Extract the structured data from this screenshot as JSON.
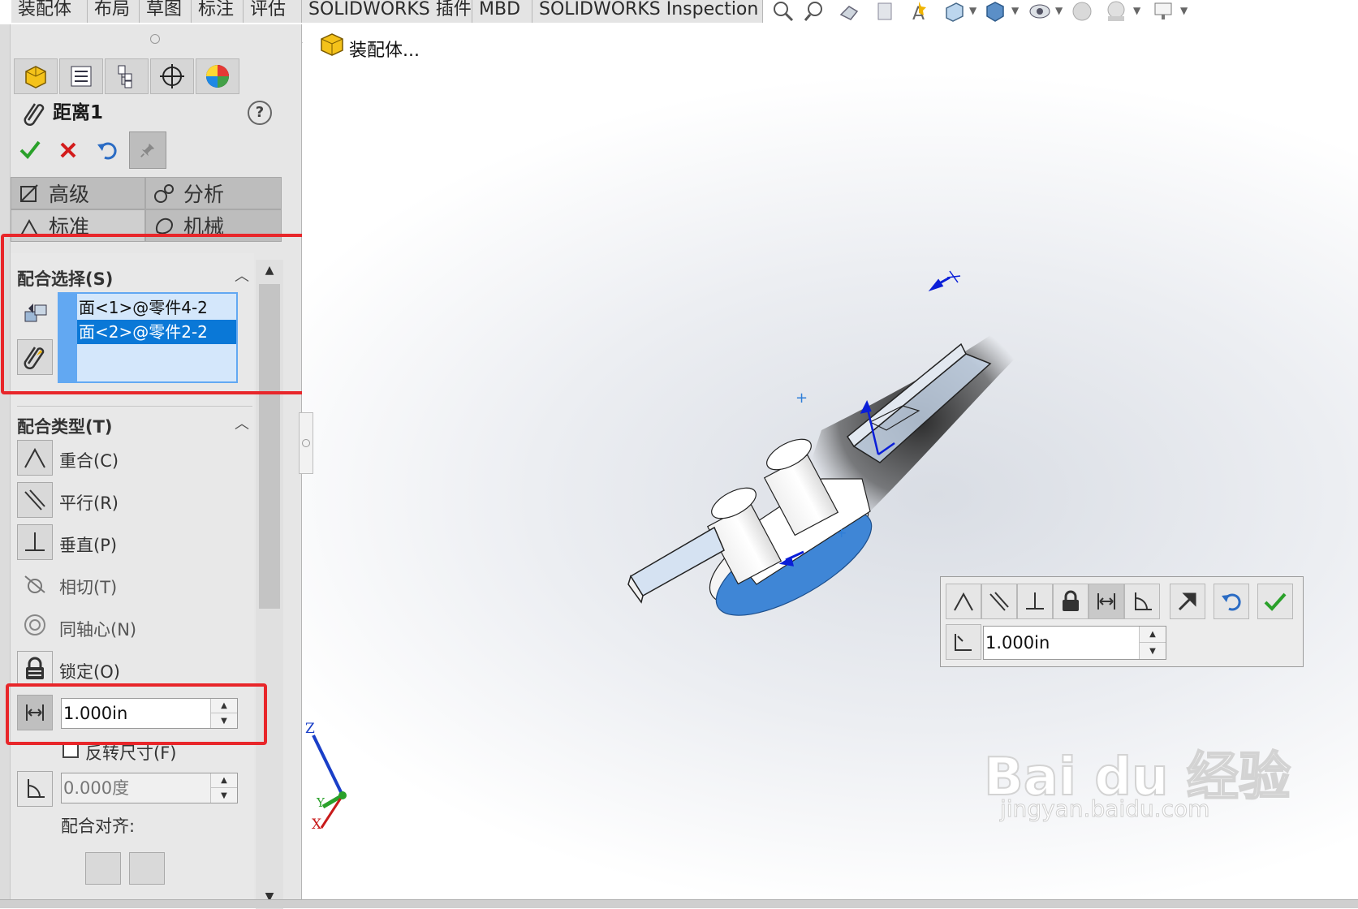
{
  "ribbon": {
    "tabs": [
      "装配体",
      "布局",
      "草图",
      "标注",
      "评估",
      "SOLIDWORKS 插件",
      "MBD",
      "SOLIDWORKS Inspection"
    ],
    "view_icons": [
      "zoom-to-fit-icon",
      "zoom-to-area-icon",
      "previous-view-icon",
      "section-view-icon",
      "dynamic-annotation-icon",
      "view-orientation-icon",
      "display-style-icon",
      "hide-show-icon",
      "edit-appearance-icon",
      "apply-scene-icon",
      "view-settings-icon"
    ]
  },
  "property_manager": {
    "tabs": [
      "feature-manager-icon",
      "property-manager-icon",
      "configuration-manager-icon",
      "dimxpert-icon",
      "display-manager-icon"
    ],
    "title": "距离1",
    "help_icon": "?",
    "pm_tabs": {
      "advanced": "高级",
      "analysis": "分析",
      "standard": "标准",
      "mechanical": "机械"
    },
    "mate_selection": {
      "title": "配合选择(S)",
      "items": [
        "面<1>@零件4-2",
        "面<2>@零件2-2"
      ]
    },
    "mate_types": {
      "title": "配合类型(T)",
      "items": [
        "重合(C)",
        "平行(R)",
        "垂直(P)",
        "相切(T)",
        "同轴心(N)",
        "锁定(O)"
      ]
    },
    "distance_value": "1.000in",
    "flip_dimension": "反转尺寸(F)",
    "angle_value": "0.000度",
    "mate_alignment": "配合对齐:"
  },
  "viewport": {
    "tree_root": "装配体...",
    "triad_labels": {
      "z": "Z",
      "y": "Y",
      "x": "X"
    },
    "watermark_brand": "Bai du 经验",
    "watermark_url": "jingyan.baidu.com"
  },
  "context_toolbar": {
    "buttons": [
      "coincident-icon",
      "parallel-icon",
      "perpendicular-icon",
      "lock-icon",
      "distance-icon",
      "angle-icon",
      "flip-alignment-icon",
      "undo-icon",
      "ok-icon"
    ],
    "distance_value": "1.000in"
  },
  "colors": {
    "accent": "#2f7ed8",
    "selection": "#0a78d7",
    "highlight_box": "#e8262a",
    "ok": "#2aa12a",
    "cancel": "#d31b1b"
  }
}
